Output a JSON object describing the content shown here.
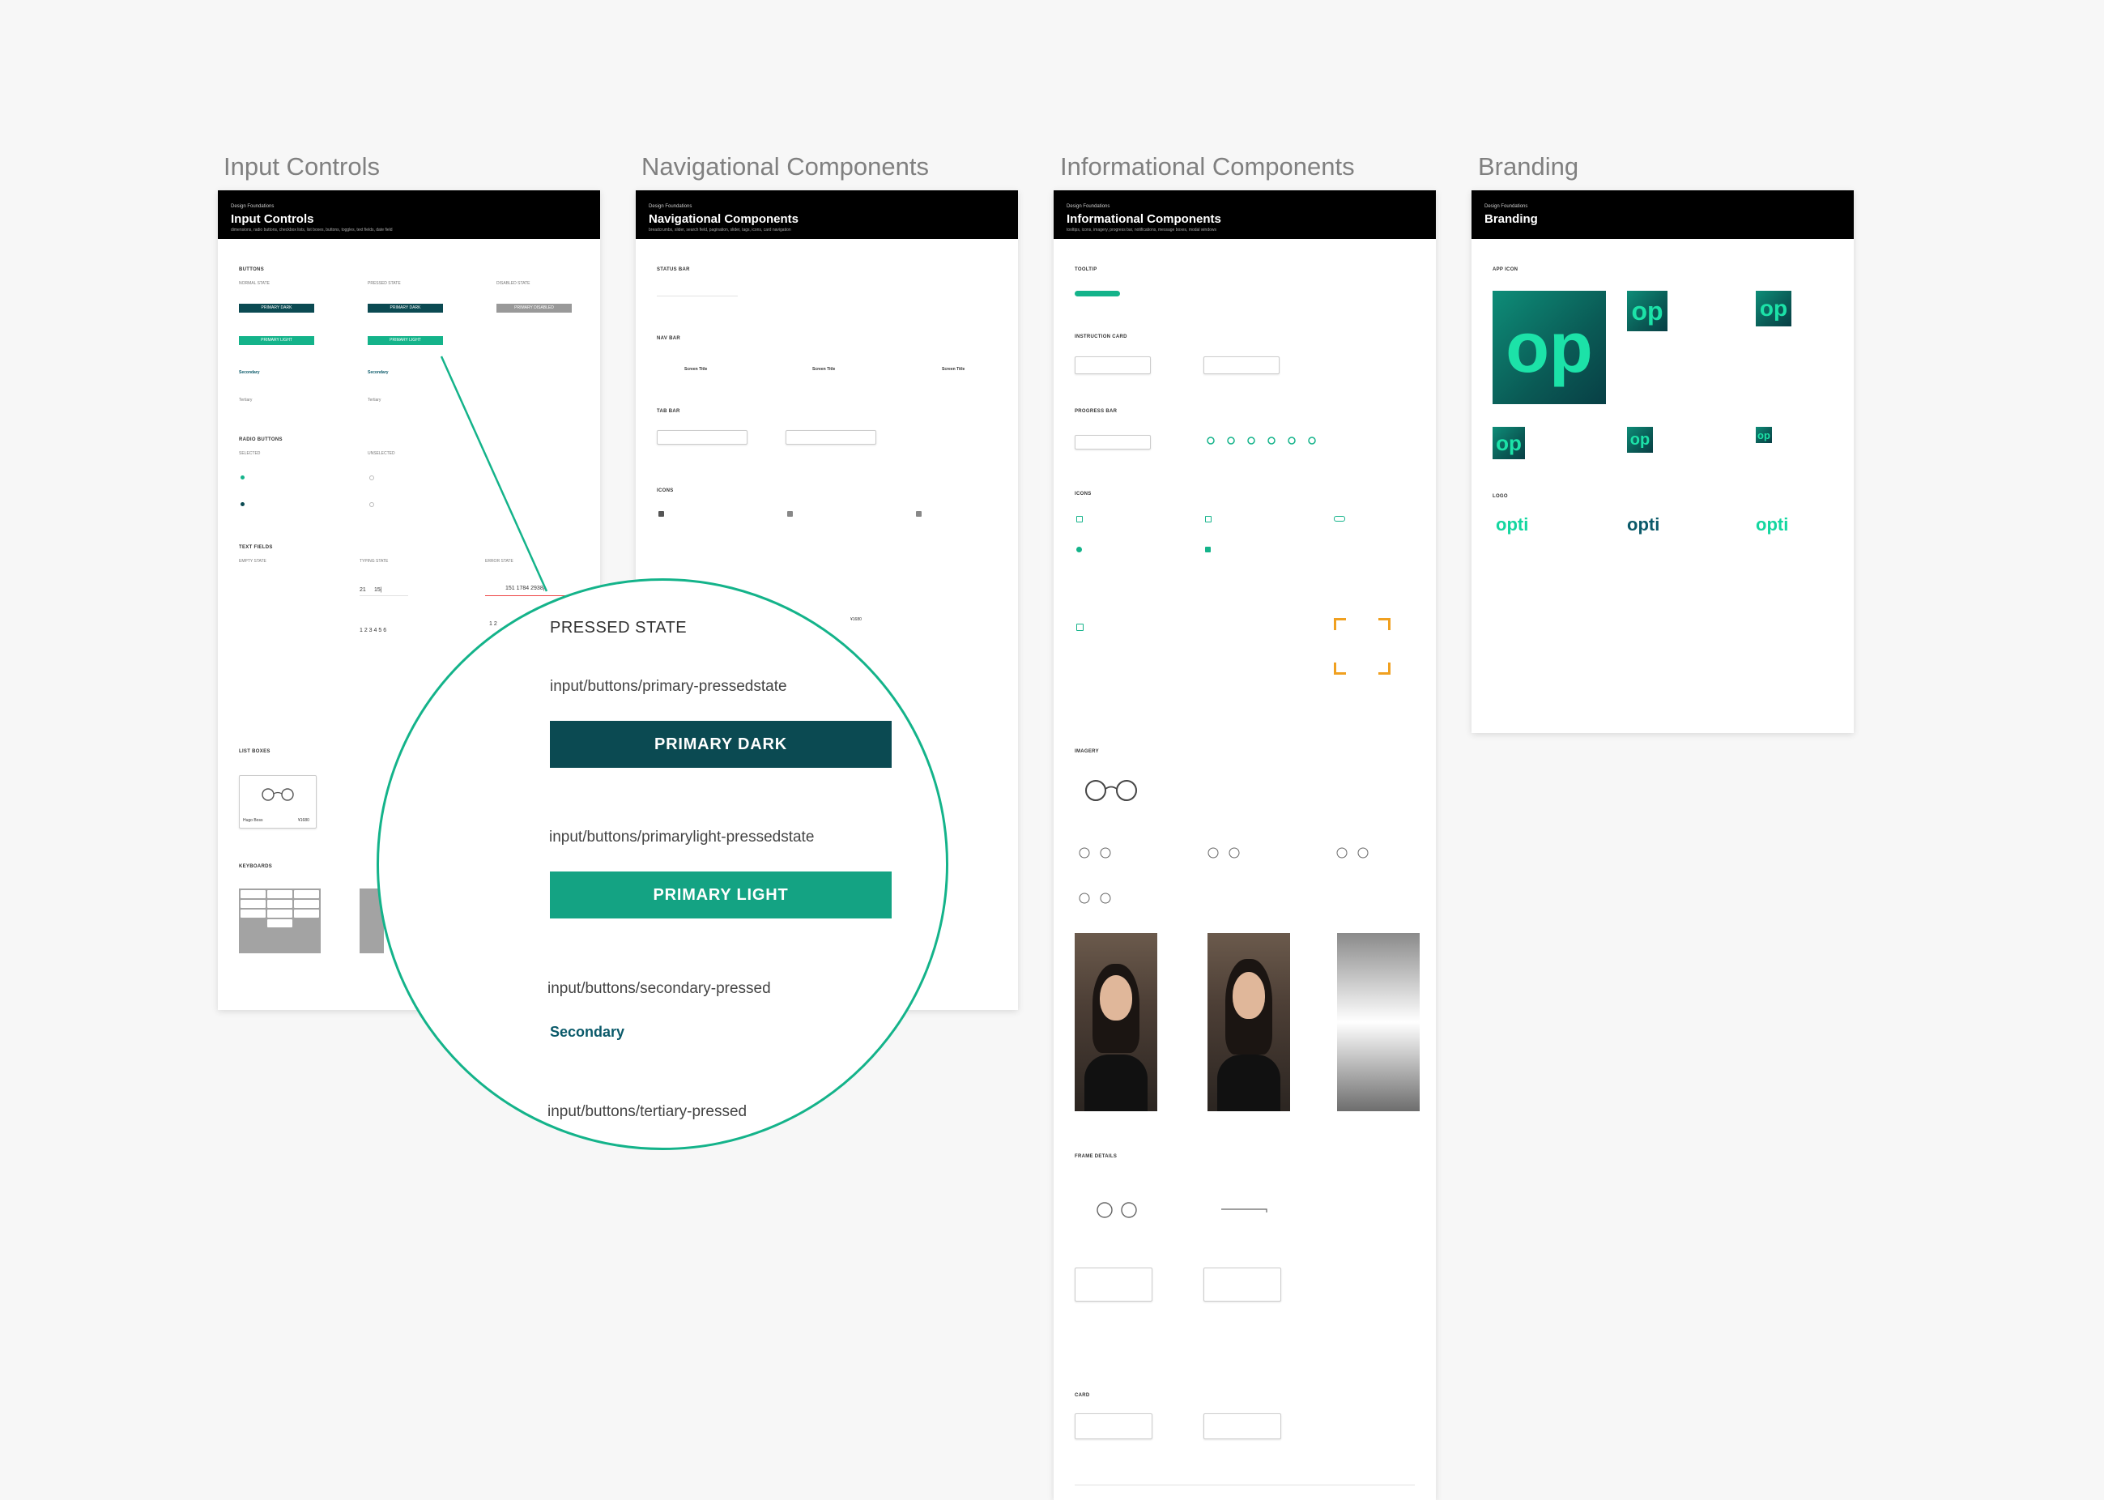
{
  "boards": {
    "input": {
      "title": "Input Controls",
      "header_sup": "Design Foundations",
      "header_title": "Input Controls",
      "header_sub": "dimensions, radio buttons, checkbox lists, list boxes, buttons, toggles, text fields, date field",
      "sections": {
        "buttons": "BUTTONS",
        "radio": "RADIO BUTTONS",
        "text_fields": "TEXT FIELDS",
        "list_boxes": "LIST BOXES",
        "keyboards": "KEYBOARDS"
      },
      "state_labels": {
        "normal": "NORMAL STATE",
        "pressed": "PRESSED STATE",
        "disabled": "DISABLED STATE",
        "selected": "SELECTED",
        "unselected": "UNSELECTED",
        "empty": "EMPTY STATE",
        "typing": "TYPING STATE",
        "error": "ERROR STATE"
      },
      "mini_buttons": {
        "primary_dark": "PRIMARY DARK",
        "primary_light": "PRIMARY LIGHT",
        "disabled": "PRIMARY DISABLED"
      },
      "mini_links": {
        "secondary": "Secondary",
        "tertiary": "Tertiary"
      },
      "text_values": {
        "date_day": "21",
        "date_month": "15|",
        "phone": "151 1784 2938|",
        "otp": "1 2 3 4 5 6",
        "otp_err": "1 2"
      },
      "list_box": {
        "name": "Hugo Boss",
        "price": "¥1680"
      }
    },
    "navigational": {
      "title": "Navigational Components",
      "header_sup": "Design Foundations",
      "header_title": "Navigational Components",
      "header_sub": "breadcrumbs, slider, search field, pagination, slider, tags, icons, card navigation",
      "sections": {
        "status_bar": "STATUS BAR",
        "nav_bar": "NAV BAR",
        "tab_bar": "TAB BAR",
        "icons": "ICONS"
      },
      "screen_title": "Screen Title",
      "price": "¥1680"
    },
    "informational": {
      "title": "Informational Components",
      "header_sup": "Design Foundations",
      "header_title": "Informational Components",
      "header_sub": "tooltips, icons, imagery, progress bar, notifications, message boxes, modal windows",
      "sections": {
        "tooltip": "TOOLTIP",
        "instruction_card": "INSTRUCTION CARD",
        "progress_bar": "PROGRESS BAR",
        "icons": "ICONS",
        "imagery": "IMAGERY",
        "frame_details": "FRAME DETAILS",
        "card": "CARD"
      }
    },
    "branding": {
      "title": "Branding",
      "header_sup": "Design Foundations",
      "header_title": "Branding",
      "sections": {
        "app_icon": "APP ICON",
        "logo": "LOGO"
      },
      "app_icon_text": "op",
      "logo_text": "opti"
    }
  },
  "magnifier": {
    "heading": "PRESSED STATE",
    "items": [
      {
        "label": "input/buttons/primary-pressedstate",
        "button": "PRIMARY DARK"
      },
      {
        "label": "input/buttons/primarylight-pressedstate",
        "button": "PRIMARY LIGHT"
      },
      {
        "label": "input/buttons/secondary-pressed",
        "link": "Secondary"
      },
      {
        "label": "input/buttons/tertiary-pressed"
      }
    ]
  },
  "colors": {
    "primary_dark": "#0b4a52",
    "primary_light": "#14b38a",
    "accent_orange": "#f0a020"
  }
}
